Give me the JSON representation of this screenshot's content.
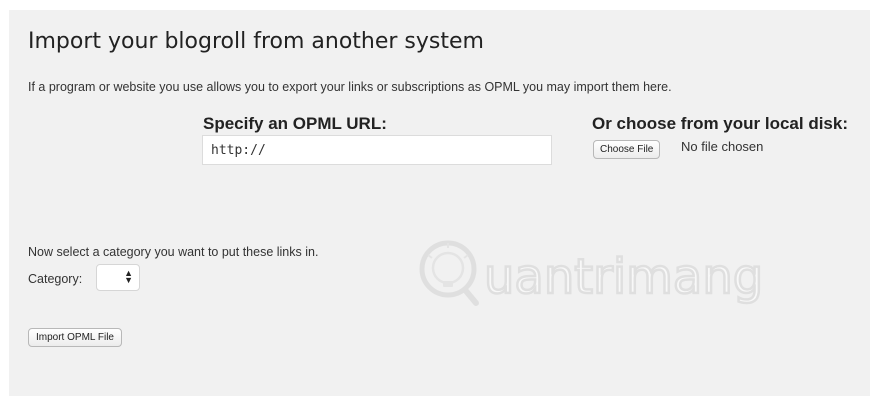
{
  "page": {
    "title": "Import your blogroll from another system",
    "intro": "If a program or website you use allows you to export your links or subscriptions as OPML you may import them here."
  },
  "opml_url": {
    "label": "Specify an OPML URL:",
    "value": "http://"
  },
  "local_file": {
    "label": "Or choose from your local disk:",
    "button_label": "Choose File",
    "status": "No file chosen"
  },
  "category": {
    "note": "Now select a category you want to put these links in.",
    "label": "Category:",
    "selected": ""
  },
  "actions": {
    "import_label": "Import OPML File"
  },
  "watermark": {
    "text": "uantrimang"
  },
  "colors": {
    "panel_background": "#f1f1f1",
    "text": "#222222",
    "input_border": "#dcdcdc"
  },
  "icons": {
    "select_arrows": "up-down-arrows-icon",
    "watermark_logo": "lightbulb-q-icon"
  }
}
